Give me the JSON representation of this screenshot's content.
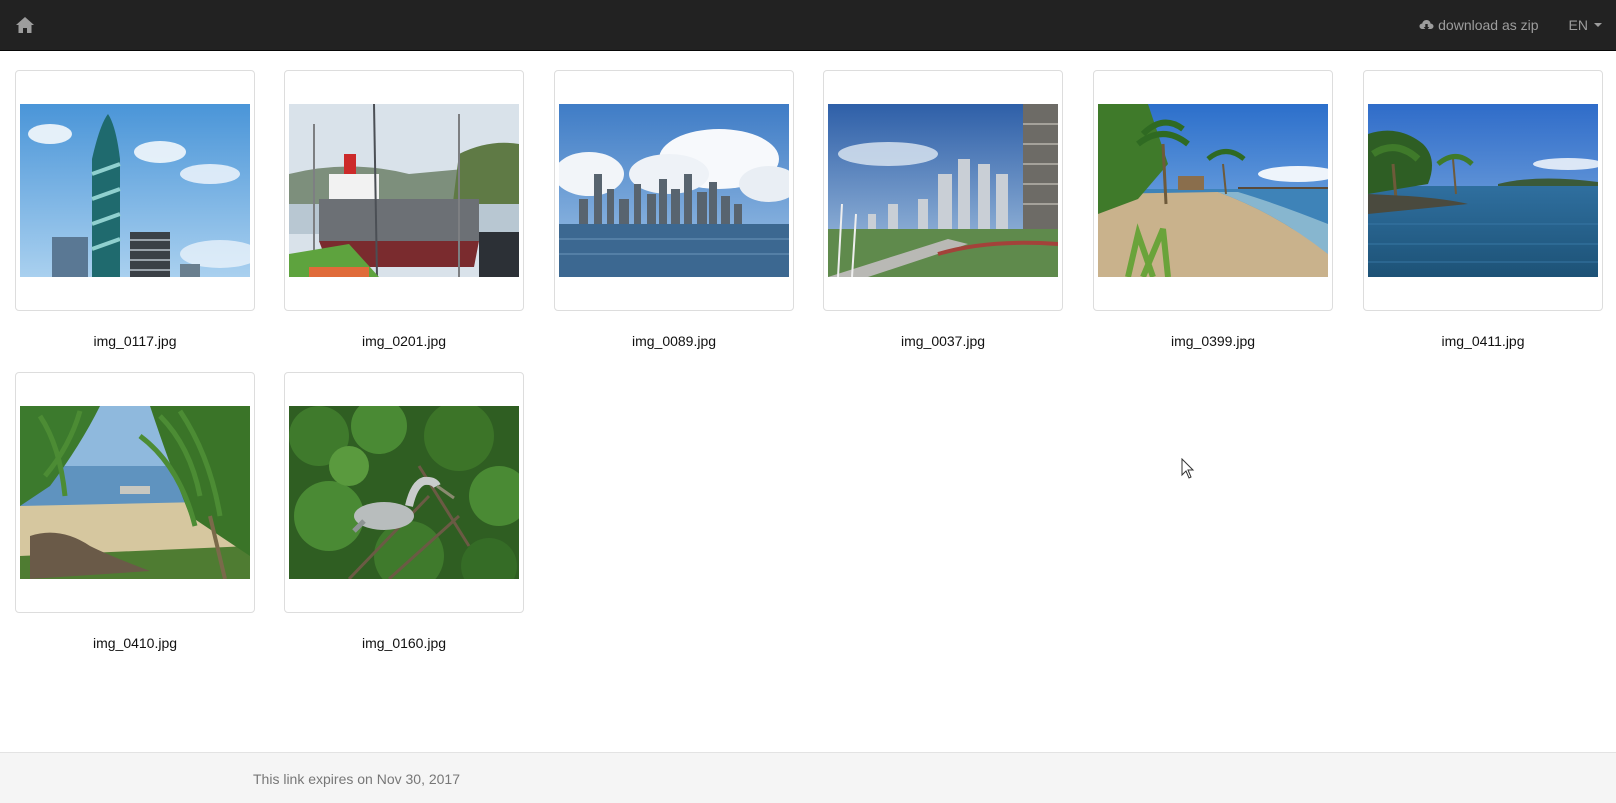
{
  "navbar": {
    "home_icon": "home-icon",
    "download_icon": "cloud-download-icon",
    "download_label": "download as zip",
    "language_label": "EN"
  },
  "gallery": {
    "items": [
      {
        "filename": "img_0117.jpg",
        "scene": "spiral tower against blue sky"
      },
      {
        "filename": "img_0201.jpg",
        "scene": "cargo ship in canal lock"
      },
      {
        "filename": "img_0089.jpg",
        "scene": "city skyline over bay"
      },
      {
        "filename": "img_0037.jpg",
        "scene": "high-rise waterfront promenade"
      },
      {
        "filename": "img_0399.jpg",
        "scene": "palm-lined sandy beach"
      },
      {
        "filename": "img_0411.jpg",
        "scene": "tropical bay with palms"
      },
      {
        "filename": "img_0410.jpg",
        "scene": "beach framed by palm fronds"
      },
      {
        "filename": "img_0160.jpg",
        "scene": "pelican in green foliage"
      }
    ]
  },
  "footer": {
    "expiry_text": "This link expires on Nov 30, 2017"
  }
}
